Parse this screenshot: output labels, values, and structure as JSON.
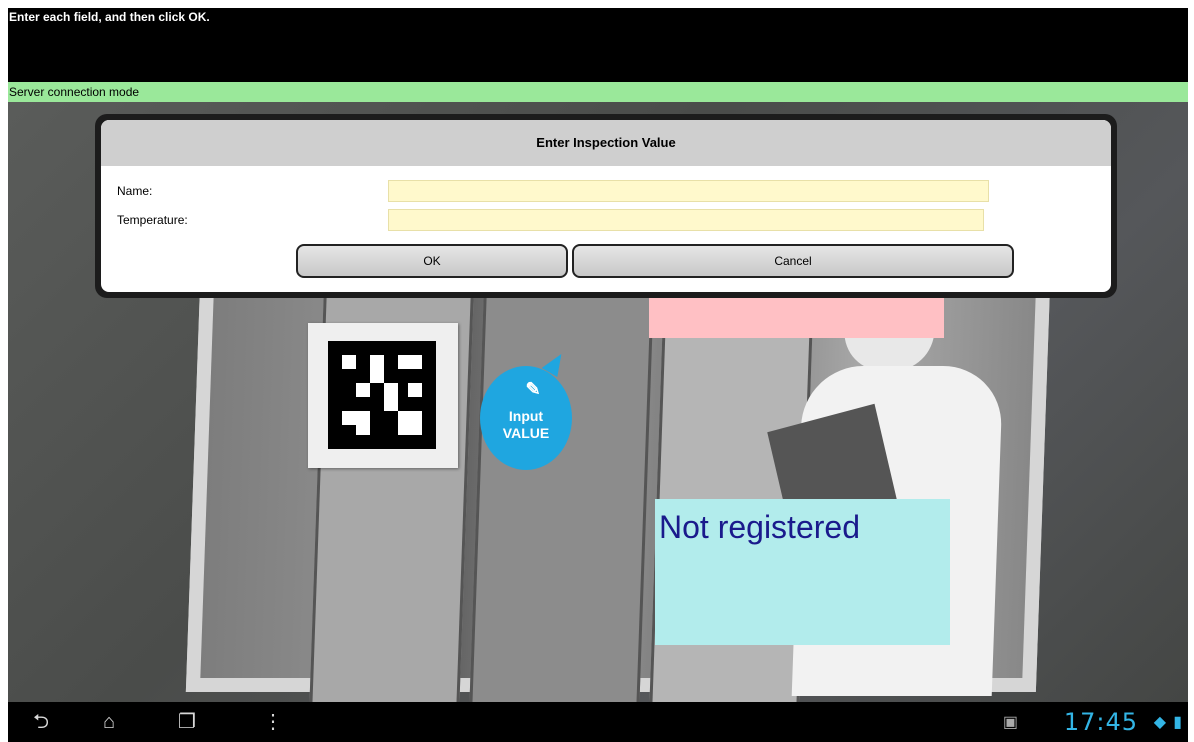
{
  "instruction": "Enter each field, and then click OK.",
  "mode": "Server connection mode",
  "dialog": {
    "title": "Enter Inspection Value",
    "fields": [
      {
        "label": "Name:",
        "value": ""
      },
      {
        "label": "Temperature:",
        "value": ""
      }
    ],
    "ok_label": "OK",
    "cancel_label": "Cancel"
  },
  "overlay": {
    "bubble_line1": "Input",
    "bubble_line2": "VALUE",
    "status": "Not registered"
  },
  "navbar": {
    "clock": "17:45",
    "icons": [
      "back-icon",
      "home-icon",
      "recent-apps-icon",
      "menu-icon",
      "screenshot-icon",
      "wifi-icon",
      "battery-icon"
    ]
  },
  "colors": {
    "mode_bar": "#9ae89a",
    "input_bg": "#fff9cc",
    "bubble": "#1fa6e0",
    "pink_box": "#ffc0c4",
    "status_box": "#b2ecec",
    "status_text": "#1a1a8c",
    "clock": "#33b5e5"
  }
}
